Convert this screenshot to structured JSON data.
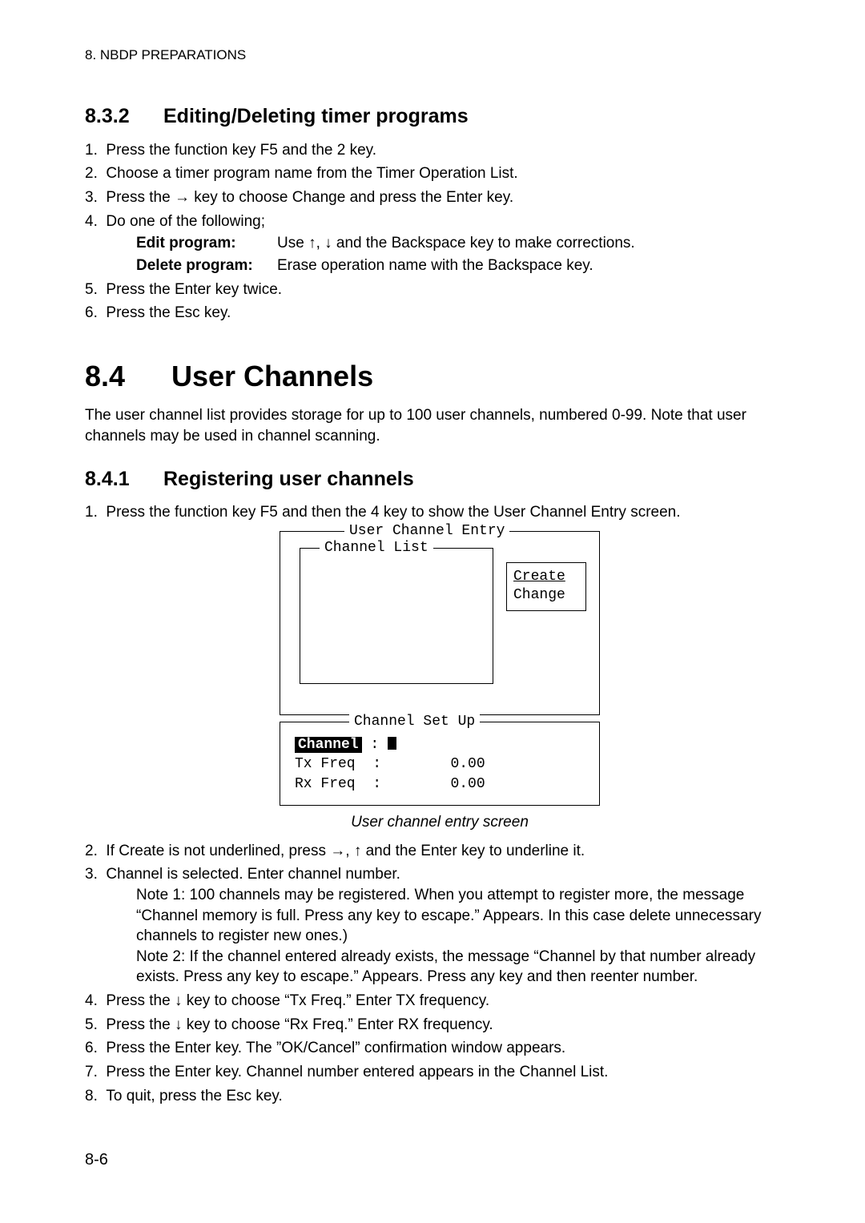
{
  "header": "8. NBDP PREPARATIONS",
  "section832": {
    "num": "8.3.2",
    "title": "Editing/Deleting timer programs",
    "steps": [
      "Press the function key F5 and the 2 key.",
      "Choose a timer program name from the Timer Operation List.",
      "Press the → key to choose Change and press the Enter key.",
      "Do one of the following;"
    ],
    "edit_label": "Edit program:",
    "edit_text": "Use ↑, ↓ and the Backspace key to make corrections.",
    "del_label": "Delete program:",
    "del_text": "Erase operation name with the Backspace key.",
    "step5": "Press the Enter key twice.",
    "step6": "Press the Esc key."
  },
  "section84": {
    "num": "8.4",
    "title": "User Channels",
    "intro": "The user channel list provides storage for up to 100 user channels, numbered 0-99. Note that user channels may be used in channel scanning."
  },
  "section841": {
    "num": "8.4.1",
    "title": "Registering user channels",
    "step1": "Press the function key F5 and then the 4 key to show the User Channel Entry screen."
  },
  "diagram": {
    "outer1_title": "User Channel Entry",
    "list_title": "Channel List",
    "menu_create": "Create",
    "menu_change": "Change",
    "outer2_title": "Channel Set Up",
    "ch_label": "Channel",
    "txfreq": "Tx Freq",
    "rxfreq": "Rx Freq",
    "tx_val": "0.00",
    "rx_val": "0.00"
  },
  "caption": "User channel entry screen",
  "steps2": {
    "s2": "If Create is not underlined, press →, ↑ and the Enter key to underline it.",
    "s3a": "Channel is selected. Enter channel number.",
    "s3b": "Note 1: 100 channels may be registered. When you attempt to register more, the message “Channel memory is full. Press any key to escape.” Appears. In this case delete unnecessary channels to register new ones.)",
    "s3c": "Note 2: If the channel entered already exists, the message “Channel by that number already exists. Press any key to escape.” Appears. Press any key and then reenter number.",
    "s4": "Press the ↓ key to choose “Tx Freq.” Enter TX frequency.",
    "s5": "Press the ↓ key to choose “Rx Freq.” Enter RX frequency.",
    "s6": "Press the Enter key. The ”OK/Cancel” confirmation window appears.",
    "s7": "Press the Enter key. Channel number entered appears in the Channel List.",
    "s8": "To quit, press the Esc key."
  },
  "page_num": "8-6"
}
